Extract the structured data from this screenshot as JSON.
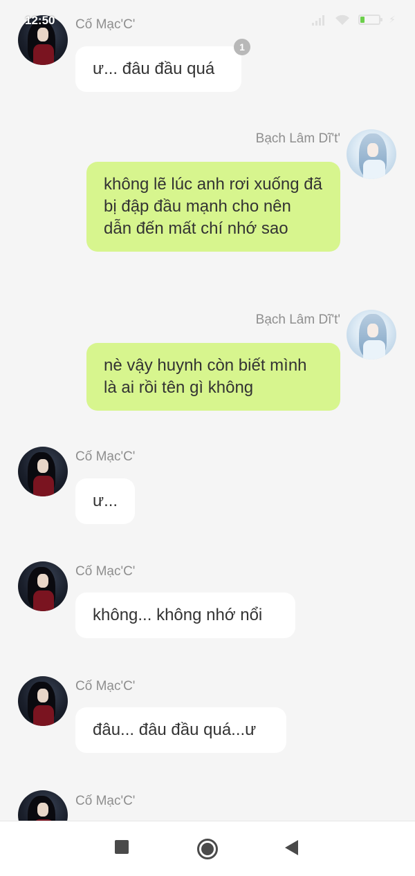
{
  "status_bar": {
    "time": "12:50",
    "signal_icon": "cell-signal-icon",
    "wifi_icon": "wifi-icon",
    "battery_icon": "battery-icon",
    "charging_icon": "charging-bolt-icon"
  },
  "colors": {
    "background": "#f5f5f5",
    "incoming_bubble": "#ffffff",
    "outgoing_bubble": "#d7f58e",
    "sender_name": "#8e8e8e",
    "unread_badge": "#b8b8b8"
  },
  "messages": [
    {
      "sender": "Cố Mạc'C'",
      "direction": "incoming",
      "text": "ư... đâu đầu quá",
      "unread_badge": "1"
    },
    {
      "sender": "Bạch Lâm Dĩ't'",
      "direction": "outgoing",
      "text": "không lẽ lúc anh rơi xuống đã bị đập đầu mạnh cho nên dẫn đến mất chí nhớ sao"
    },
    {
      "sender": "Bạch Lâm Dĩ't'",
      "direction": "outgoing",
      "text": "nè vậy huynh còn biết mình là ai rồi tên gì không"
    },
    {
      "sender": "Cố Mạc'C'",
      "direction": "incoming",
      "text": "ư..."
    },
    {
      "sender": "Cố Mạc'C'",
      "direction": "incoming",
      "text": "không... không nhớ nổi"
    },
    {
      "sender": "Cố Mạc'C'",
      "direction": "incoming",
      "text": "đâu... đâu đầu quá...ư"
    },
    {
      "sender": "Cố Mạc'C'",
      "direction": "incoming",
      "text": ""
    }
  ],
  "nav_bar": {
    "recents_icon": "square-recents-icon",
    "home_icon": "circle-home-icon",
    "back_icon": "triangle-back-icon"
  }
}
